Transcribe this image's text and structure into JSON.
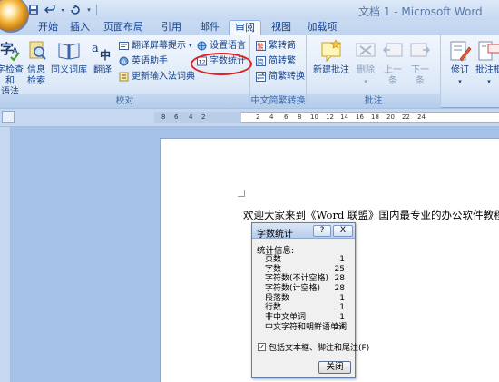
{
  "window": {
    "title": "文档 1 - Microsoft Word"
  },
  "quick_access": {
    "save_icon": "save-icon",
    "undo_icon": "undo-icon",
    "redo_icon": "redo-icon",
    "customize_icon": "customize-icon"
  },
  "tabs": [
    {
      "label": "开始"
    },
    {
      "label": "插入"
    },
    {
      "label": "页面布局"
    },
    {
      "label": "引用"
    },
    {
      "label": "邮件"
    },
    {
      "label": "审阅"
    },
    {
      "label": "视图"
    },
    {
      "label": "加载项"
    }
  ],
  "active_tab": "审阅",
  "ribbon": {
    "proofing": {
      "label": "校对",
      "spelling_label_1": "字检查和",
      "spelling_label_2": "语法",
      "research_label_1": "信息",
      "research_label_2": "检索",
      "thesaurus_label": "同义词库",
      "translate_label": "翻译",
      "translate_tip": "翻译屏幕提示",
      "english_assistant": "英语助手",
      "update_ime": "更新输入法词典",
      "set_language": "设置语言",
      "word_count": "字数统计"
    },
    "chinese_conversion": {
      "label": "中文简繁转换",
      "to_traditional": "繁转简",
      "to_simplified": "简转繁",
      "conversion": "简繁转换"
    },
    "comments": {
      "label": "批注",
      "new_comment": "新建批注",
      "delete": "删除",
      "previous_1": "上一",
      "previous_2": "条",
      "next_1": "下一",
      "next_2": "条"
    },
    "tracking": {
      "track_changes": "修订",
      "balloons": "批注框"
    }
  },
  "ruler": {
    "numbers": [
      "8",
      "6",
      "4",
      "2",
      "2",
      "4",
      "6",
      "8",
      "10",
      "12",
      "14",
      "16",
      "18",
      "20",
      "22",
      "24"
    ]
  },
  "document": {
    "text": "欢迎大家来到《Word 联盟》国内最专业的办公软件教程网!"
  },
  "dialog": {
    "title": "字数统计",
    "help": "?",
    "close_x": "X",
    "stats_header": "统计信息:",
    "stats": [
      {
        "label": "页数",
        "value": "1"
      },
      {
        "label": "字数",
        "value": "25"
      },
      {
        "label": "字符数(不计空格)",
        "value": "28"
      },
      {
        "label": "字符数(计空格)",
        "value": "28"
      },
      {
        "label": "段落数",
        "value": "1"
      },
      {
        "label": "行数",
        "value": "1"
      },
      {
        "label": "非中文单词",
        "value": "1"
      },
      {
        "label": "中文字符和朝鲜语单词",
        "value": "24"
      }
    ],
    "include_label": "包括文本框、脚注和尾注(F)",
    "include_checked": true,
    "close_button": "关闭"
  }
}
